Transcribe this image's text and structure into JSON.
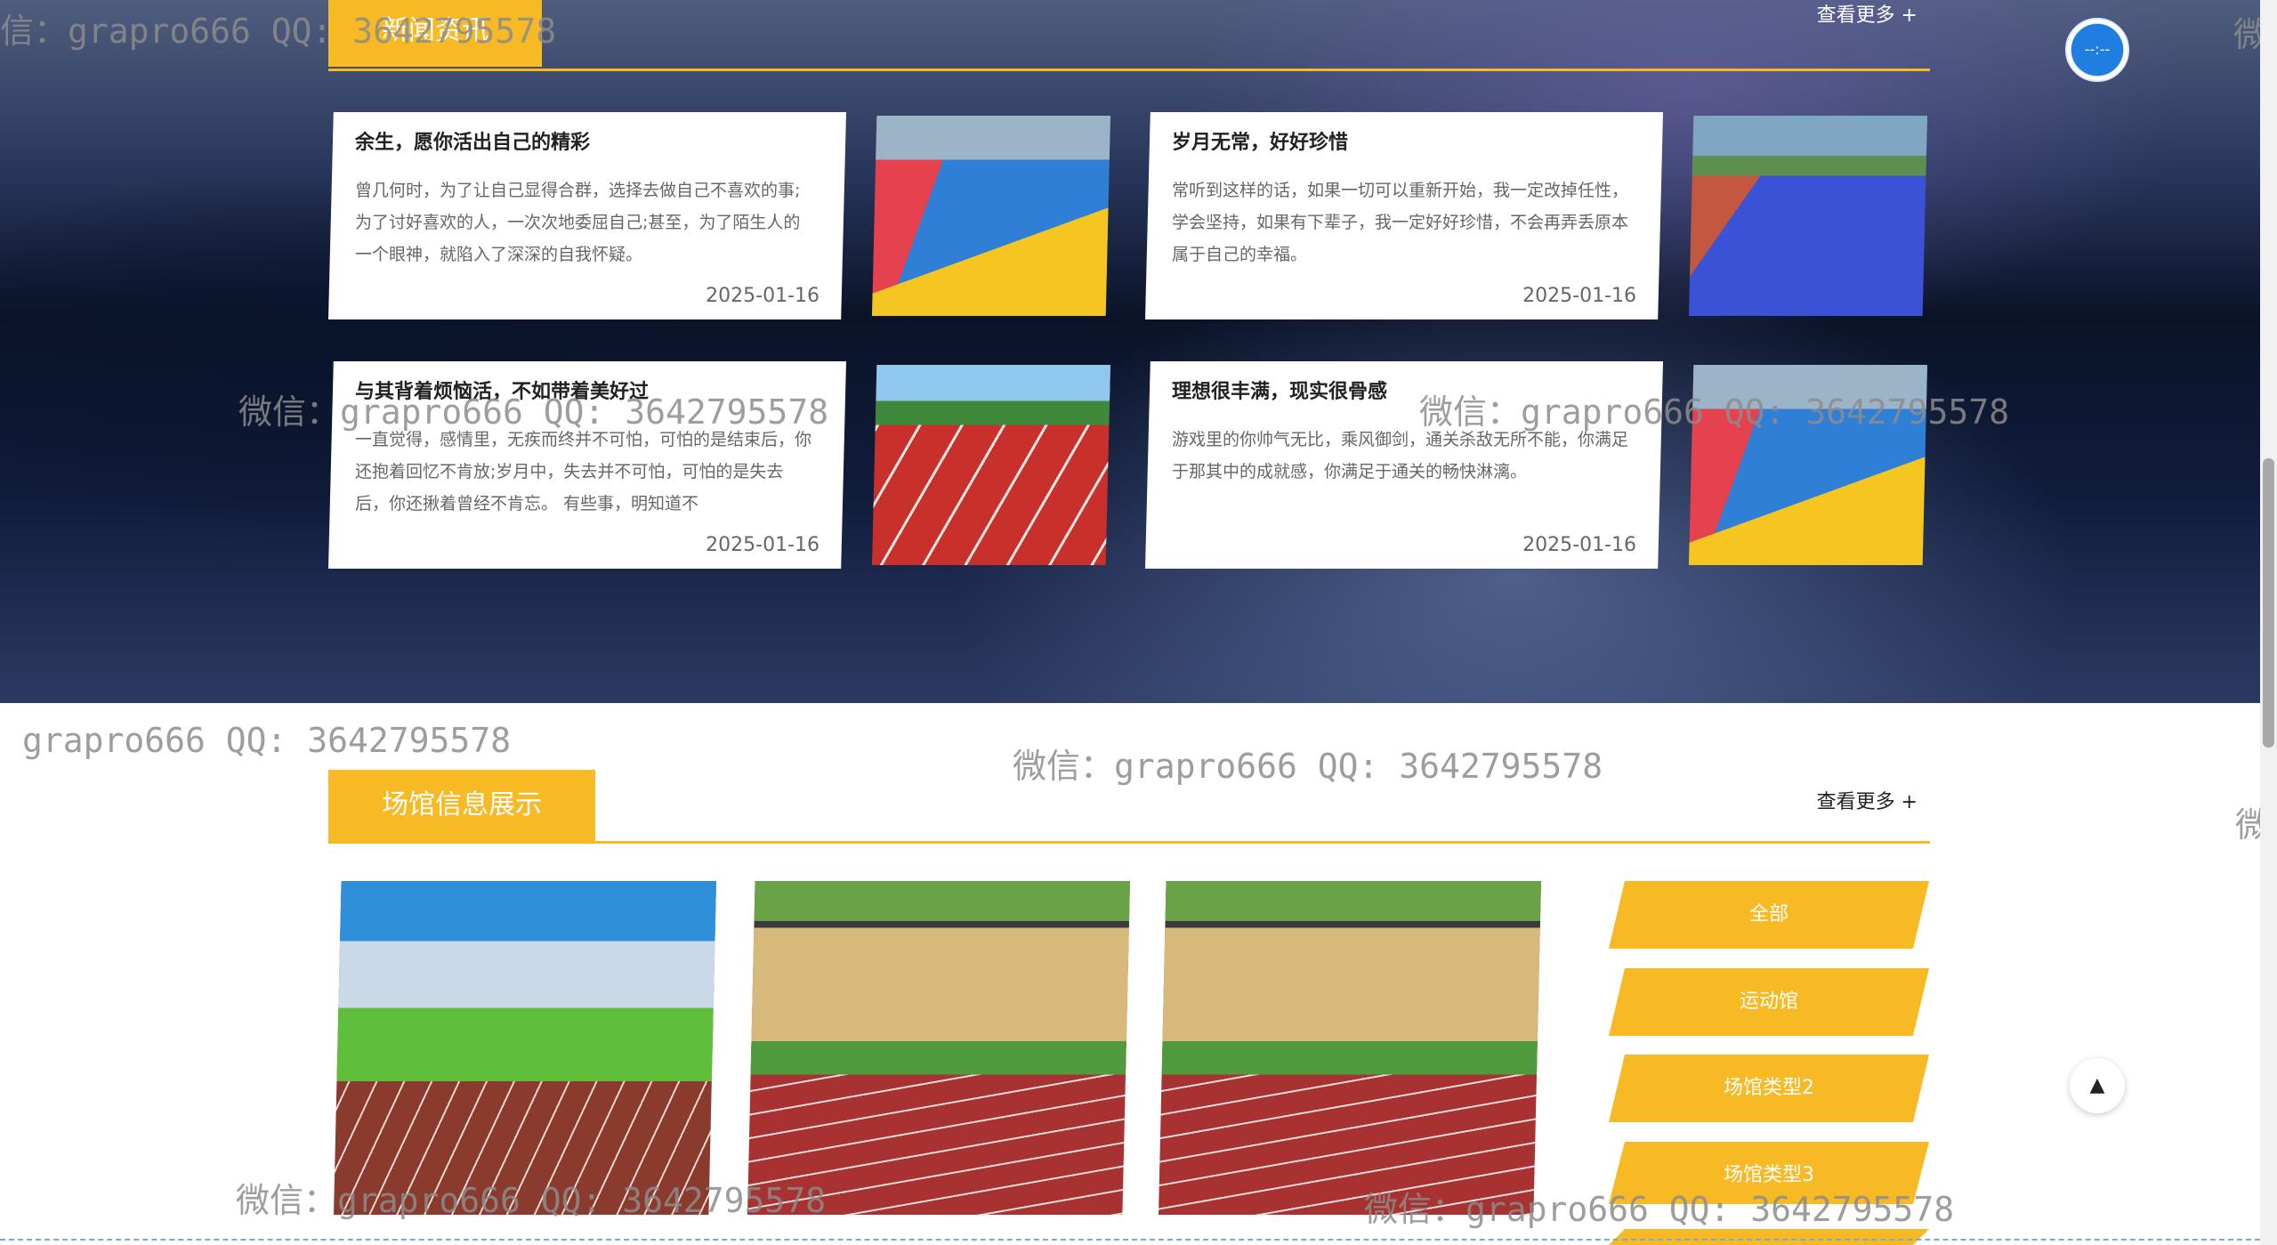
{
  "news": {
    "title": "新闻资讯",
    "more": "查看更多 +",
    "items": [
      {
        "title": "余生，愿你活出自己的精彩",
        "summary": "曾几何时，为了让自己显得合群，选择去做自己不喜欢的事;为了讨好喜欢的人，一次次地委屈自己;甚至，为了陌生人的一个眼神，就陷入了深深的自我怀疑。",
        "date": "2025-01-16"
      },
      {
        "title": "岁月无常，好好珍惜",
        "summary": "常听到这样的话，如果一切可以重新开始，我一定改掉任性，学会坚持，如果有下辈子，我一定好好珍惜，不会再弄丢原本属于自己的幸福。",
        "date": "2025-01-16"
      },
      {
        "title": "与其背着烦恼活，不如带着美好过",
        "summary": "一直觉得，感情里，无疾而终并不可怕，可怕的是结束后，你还抱着回忆不肯放;岁月中，失去并不可怕，可怕的是失去后，你还揪着曾经不肯忘。 有些事，明知道不",
        "date": "2025-01-16"
      },
      {
        "title": "理想很丰满，现实很骨感",
        "summary": "游戏里的你帅气无比，乘风御剑，通关杀敌无所不能，你满足于那其中的成就感，你满足于通关的畅快淋漓。",
        "date": "2025-01-16"
      }
    ]
  },
  "venue": {
    "title": "场馆信息展示",
    "more": "查看更多 +",
    "filters": [
      "全部",
      "运动馆",
      "场馆类型2",
      "场馆类型3"
    ]
  },
  "watermarks": [
    "信：grapro666 QQ: 3642795578",
    "微信：grapro666 QQ: 3642795578",
    "微信：grapro666 QQ: 3642795578",
    "grapro666 QQ: 3642795578",
    "微信：grapro666 QQ: 3642795578",
    "微信：grapro666 QQ: 3642795578",
    "微信：grapro666 QQ: 3642795578",
    "微信",
    "微信"
  ],
  "float_button": "--:--",
  "back_to_top": "▲",
  "colors": {
    "accent": "#f7b924",
    "float": "#1f7ee0"
  }
}
